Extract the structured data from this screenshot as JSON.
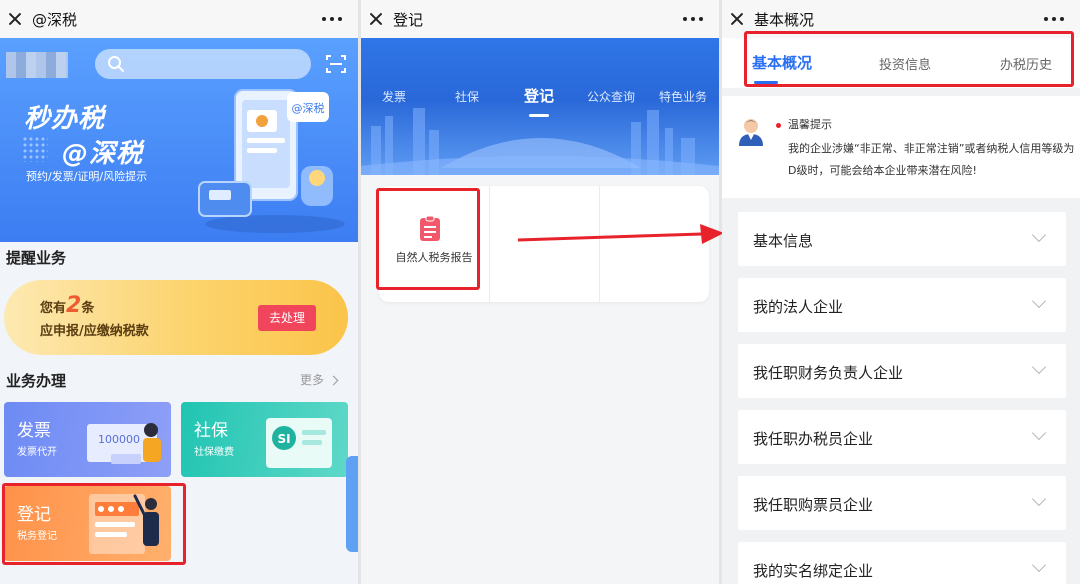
{
  "panel1": {
    "window_title": "@深税",
    "banner": {
      "title_line1": "秒办税",
      "title_line2": "@深税",
      "subtitle": "预约/发票/证明/风险提示",
      "badge": "@深税"
    },
    "reminders": {
      "section_title": "提醒业务",
      "prefix": "您有",
      "count": "2",
      "suffix": "条",
      "line2": "应申报/应缴纳税款",
      "action_label": "去处理"
    },
    "services": {
      "section_title": "业务办理",
      "more_label": "更多",
      "items": [
        {
          "name": "发票",
          "sub": "发票代开",
          "illus_text": "100000"
        },
        {
          "name": "社保",
          "sub": "社保缴费"
        },
        {
          "name": "登记",
          "sub": "税务登记"
        }
      ]
    }
  },
  "panel2": {
    "window_title": "登记",
    "tabs": [
      "发票",
      "社保",
      "登记",
      "公众查询",
      "特色业务"
    ],
    "active_tab": 2,
    "grid_items": [
      {
        "label": "自然人税务报告",
        "icon": "document-icon"
      }
    ]
  },
  "panel3": {
    "window_title": "基本概况",
    "tabs": [
      "基本概况",
      "投资信息",
      "办税历史"
    ],
    "active_tab": 0,
    "notice": {
      "title": "温馨提示",
      "body": "我的企业涉嫌“非正常、非正常注销”或者纳税人信用等级为D级时，可能会给本企业带来潜在风险!"
    },
    "accordion": [
      "基本信息",
      "我的法人企业",
      "我任职财务负责人企业",
      "我任职办税员企业",
      "我任职购票员企业",
      "我的实名绑定企业"
    ]
  },
  "colors": {
    "accent_blue": "#2a6ff2",
    "highlight_red": "#e8222b",
    "reminder_button": "#f0455b"
  }
}
